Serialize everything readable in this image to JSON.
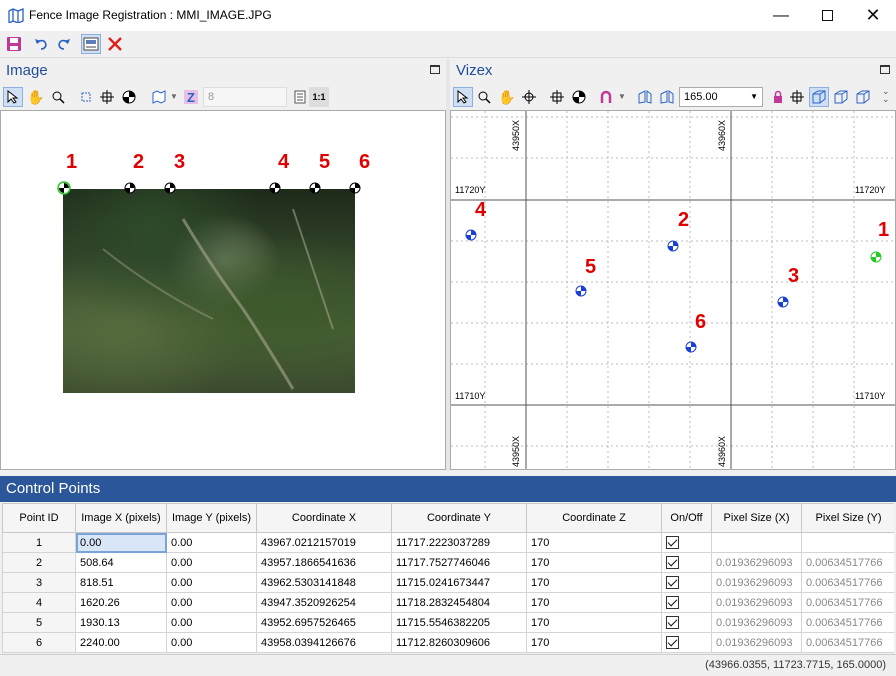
{
  "window": {
    "title": "Fence Image Registration : MMI_IMAGE.JPG"
  },
  "image_panel": {
    "title": "Image",
    "spin_value": "8",
    "points": [
      {
        "label": "1",
        "active": true
      },
      {
        "label": "2"
      },
      {
        "label": "3"
      },
      {
        "label": "4"
      },
      {
        "label": "5"
      },
      {
        "label": "6"
      }
    ]
  },
  "vizex_panel": {
    "title": "Vizex",
    "elevation_value": "165.00",
    "grid_labels": {
      "x_left": "43950X",
      "x_right": "43960X",
      "y_top": "11720Y",
      "y_bottom": "11710Y"
    },
    "points": [
      {
        "label": "1",
        "active": true
      },
      {
        "label": "2"
      },
      {
        "label": "3"
      },
      {
        "label": "4"
      },
      {
        "label": "5"
      },
      {
        "label": "6"
      }
    ]
  },
  "control_points": {
    "title": "Control Points",
    "columns": [
      "Point ID",
      "Image X (pixels)",
      "Image Y (pixels)",
      "Coordinate X",
      "Coordinate Y",
      "Coordinate Z",
      "On/Off",
      "Pixel Size (X)",
      "Pixel Size (Y)"
    ],
    "rows": [
      {
        "id": "1",
        "ix": "0.00",
        "iy": "0.00",
        "cx": "43967.0212157019",
        "cy": "11717.2223037289",
        "cz": "170",
        "on": true,
        "psx": "",
        "psy": ""
      },
      {
        "id": "2",
        "ix": "508.64",
        "iy": "0.00",
        "cx": "43957.1866541636",
        "cy": "11717.7527746046",
        "cz": "170",
        "on": true,
        "psx": "0.01936296093",
        "psy": "0.00634517766"
      },
      {
        "id": "3",
        "ix": "818.51",
        "iy": "0.00",
        "cx": "43962.5303141848",
        "cy": "11715.0241673447",
        "cz": "170",
        "on": true,
        "psx": "0.01936296093",
        "psy": "0.00634517766"
      },
      {
        "id": "4",
        "ix": "1620.26",
        "iy": "0.00",
        "cx": "43947.3520926254",
        "cy": "11718.2832454804",
        "cz": "170",
        "on": true,
        "psx": "0.01936296093",
        "psy": "0.00634517766"
      },
      {
        "id": "5",
        "ix": "1930.13",
        "iy": "0.00",
        "cx": "43952.6957526465",
        "cy": "11715.5546382205",
        "cz": "170",
        "on": true,
        "psx": "0.01936296093",
        "psy": "0.00634517766"
      },
      {
        "id": "6",
        "ix": "2240.00",
        "iy": "0.00",
        "cx": "43958.0394126676",
        "cy": "11712.8260309606",
        "cz": "170",
        "on": true,
        "psx": "0.01936296093",
        "psy": "0.00634517766"
      }
    ]
  },
  "status": {
    "coords": "(43966.0355, 11723.7715, 165.0000)"
  },
  "colors": {
    "accent": "#2b579a",
    "label_red": "#e00000",
    "marker_blue": "#1a3fd6",
    "marker_green": "#22cc22"
  }
}
